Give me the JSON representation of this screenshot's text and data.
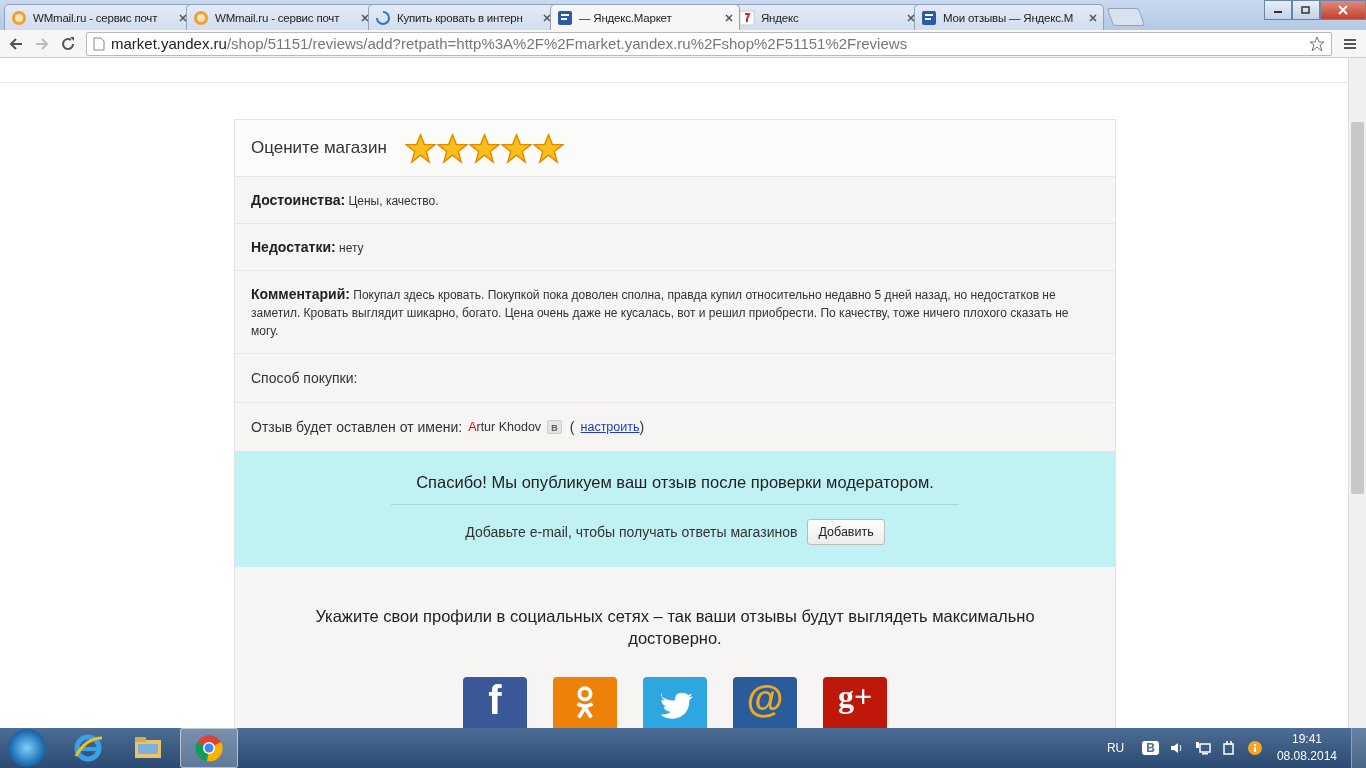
{
  "browser": {
    "tabs": [
      {
        "title": "WMmail.ru - сервис почт",
        "selected": false
      },
      {
        "title": "WMmail.ru - сервис почт",
        "selected": false
      },
      {
        "title": "Купить кровать в интерн",
        "selected": false
      },
      {
        "title": "— Яндекс.Маркет",
        "selected": true
      },
      {
        "title": "Яндекс",
        "selected": false
      },
      {
        "title": "Мои отзывы — Яндекс.М",
        "selected": false
      }
    ],
    "url_host": "market.yandex.ru",
    "url_path": "/shop/51151/reviews/add?retpath=http%3A%2F%2Fmarket.yandex.ru%2Fshop%2F51151%2Freviews"
  },
  "review": {
    "rate_label": "Оцените магазин",
    "stars": 5,
    "fields": [
      {
        "label": "Достоинства:",
        "value": "Цены, качество."
      },
      {
        "label": "Недостатки:",
        "value": "нету"
      },
      {
        "label": "Комментарий:",
        "value": "Покупал здесь кровать. Покупкой пока доволен сполна, правда купил относительно недавно 5 дней назад, но недостатков не заметил. Кровать выглядит шикарно, богато. Цена очень даже не кусалась, вот и решил приобрести. По качеству, тоже ничего плохого сказать не могу."
      }
    ],
    "purchase_label": "Способ покупки:",
    "author_label": "Отзыв будет оставлен от имени:",
    "author_first": "A",
    "author_rest": "rtur Khodov",
    "author_badge": "в",
    "settings_open": "(",
    "settings_link": "настроить",
    "settings_close": ")"
  },
  "thanks": {
    "message": "Спасибо! Мы опубликуем ваш отзыв после проверки модератором.",
    "email_prompt": "Добавьте e-mail, чтобы получать ответы магазинов",
    "add_button": "Добавить"
  },
  "social": {
    "prompt": "Укажите свои профили в социальных сетях – так ваши отзывы будут выглядеть максимально достоверно.",
    "networks": [
      {
        "kind": "facebook",
        "glyph": "f",
        "color": "#3b5998"
      },
      {
        "kind": "odnoklassniki",
        "color": "#ee8208"
      },
      {
        "kind": "twitter",
        "color": "#2ea7e0"
      },
      {
        "kind": "mail",
        "glyph": "@",
        "color": "#2a5c9b"
      },
      {
        "kind": "google",
        "glyph": "g+",
        "color": "#c0170b"
      }
    ]
  },
  "taskbar": {
    "language": "RU",
    "tray_badge": "В",
    "time": "19:41",
    "date": "08.08.2014"
  }
}
